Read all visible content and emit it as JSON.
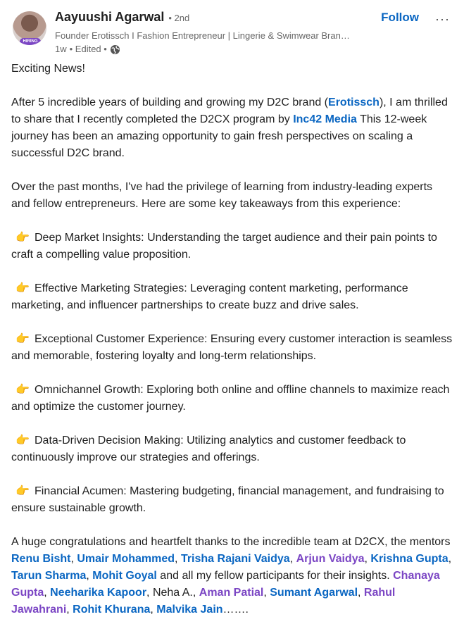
{
  "post": {
    "author": {
      "name": "Aayuushi Agarwal",
      "degree": "• 2nd",
      "headline": "Founder Erotissch I Fashion Entrepreneur | Lingerie & Swimwear Bran…",
      "time": "1w",
      "edited": "• Edited •",
      "avatar_badge": "HIRING",
      "visibility_icon": "globe-icon"
    },
    "follow_label": "Follow",
    "more_label": "···",
    "greeting": "Exciting News!",
    "intro": {
      "t1": "After 5 incredible years of building and growing my D2C brand (",
      "brand": "Erotissch",
      "t2": "), I am thrilled to share that I recently completed the D2CX program by ",
      "org": "Inc42 Media",
      "t3": " This 12-week journey has been an amazing opportunity to gain fresh perspectives on scaling a successful D2C brand."
    },
    "lead": "Over the past months, I've had the privilege of learning from industry-leading experts and fellow entrepreneurs. Here are some key takeaways from this experience:",
    "bullet_emoji": "👉",
    "bullets": [
      "Deep Market Insights: Understanding the target audience and their pain points to craft a compelling value proposition.",
      "Effective Marketing Strategies: Leveraging content marketing, performance marketing, and influencer partnerships to create buzz and drive sales.",
      "Exceptional Customer Experience: Ensuring every customer interaction is seamless and memorable, fostering loyalty and long-term relationships.",
      "Omnichannel Growth: Exploring both online and offline channels to maximize reach and optimize the customer journey.",
      "Data-Driven Decision Making: Utilizing analytics and customer feedback to continuously improve our strategies and offerings.",
      "Financial Acumen: Mastering budgeting, financial management, and fundraising to ensure sustainable growth."
    ],
    "thanks": {
      "t1": "A huge congratulations and heartfelt thanks to the incredible team at D2CX, the mentors ",
      "m1": "Renu Bisht",
      "c1": ", ",
      "m2": "Umair Mohammed",
      "c2": ", ",
      "m3": "Trisha Rajani Vaidya",
      "c3": ", ",
      "m4": "Arjun Vaidya",
      "c4": ", ",
      "m5": "Krishna Gupta",
      "c5": ", ",
      "m6": "Tarun Sharma",
      "c6": ", ",
      "m7": "Mohit Goyal",
      "t2": " and all my fellow participants for their insights. ",
      "p1": "Chanaya Gupta",
      "c7": ", ",
      "p2": "Neeharika Kapoor",
      "t3": ", Neha A., ",
      "p3": "Aman Patial",
      "c8": ", ",
      "p4": "Sumant Agarwal",
      "c9": ", ",
      "p5": "Rahul Jawahrani",
      "c10": ", ",
      "p6": "Rohit Khurana",
      "c11": ", ",
      "p7": "Malvika Jain",
      "t4": "……."
    },
    "colors": {
      "link_blue": "#0a66c2",
      "link_purple": "#7b46c4"
    }
  }
}
